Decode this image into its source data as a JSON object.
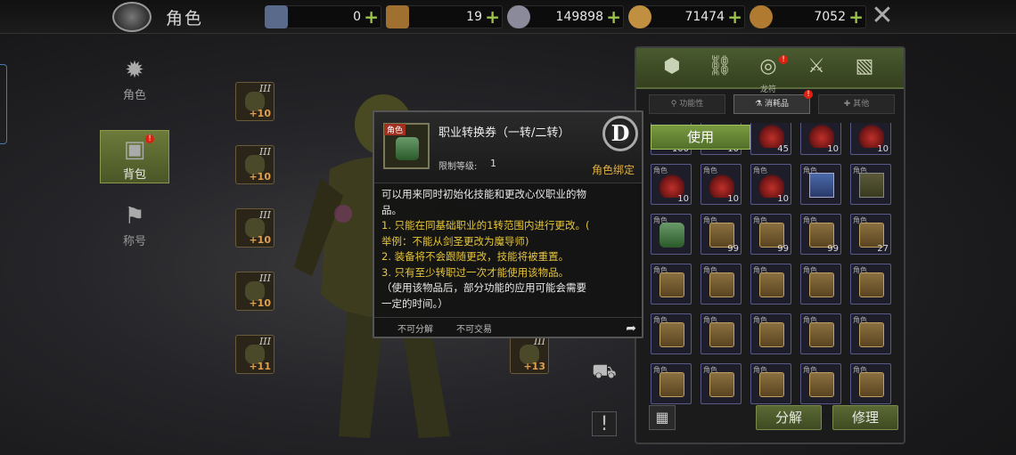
{
  "header": {
    "title": "角色",
    "currencies": [
      {
        "icon": "ticket-card-icon",
        "value": "0",
        "color": "#5a6a8a"
      },
      {
        "icon": "scroll-ticket-icon",
        "value": "19",
        "color": "#a07030"
      },
      {
        "icon": "gear-coin-icon",
        "value": "149898",
        "color": "#8a8a9a"
      },
      {
        "icon": "gold-coin-icon",
        "value": "71474",
        "color": "#c09040"
      },
      {
        "icon": "bronze-coin-icon",
        "value": "7052",
        "color": "#b07a30"
      }
    ],
    "plus": "+"
  },
  "leftnav": [
    {
      "label": "角色",
      "icon": "character-icon"
    },
    {
      "label": "背包",
      "icon": "backpack-icon",
      "badge": "!"
    },
    {
      "label": "称号",
      "icon": "title-icon"
    }
  ],
  "equip_left": [
    {
      "tier": "III",
      "level": "+10"
    },
    {
      "tier": "III",
      "level": "+10"
    },
    {
      "tier": "III",
      "level": "+10"
    },
    {
      "tier": "III",
      "level": "+10"
    },
    {
      "tier": "III",
      "level": "+11"
    }
  ],
  "equip_right": [
    {
      "tier": "III",
      "level": "+13"
    }
  ],
  "inventory": {
    "tabs": [
      {
        "icon": "cube-icon",
        "label": ""
      },
      {
        "icon": "link-icon",
        "label": ""
      },
      {
        "icon": "cosmetic-icon",
        "label": "龙符",
        "badge": "!"
      },
      {
        "icon": "sword-icon",
        "label": ""
      },
      {
        "icon": "map-icon",
        "label": ""
      }
    ],
    "subtabs": [
      {
        "label": "功能性",
        "icon": "magnifier-icon"
      },
      {
        "label": "消耗品",
        "icon": "potion-icon",
        "badge": "!"
      },
      {
        "label": "其他",
        "icon": "cross-icon"
      }
    ],
    "slots": [
      {
        "cat": "",
        "count": "100",
        "kind": "red"
      },
      {
        "cat": "",
        "count": "10",
        "kind": "red"
      },
      {
        "cat": "",
        "count": "45",
        "kind": "red"
      },
      {
        "cat": "",
        "count": "10",
        "kind": "red"
      },
      {
        "cat": "",
        "count": "10",
        "kind": "red"
      },
      {
        "cat": "角色",
        "count": "10",
        "kind": "red"
      },
      {
        "cat": "角色",
        "count": "10",
        "kind": "red"
      },
      {
        "cat": "角色",
        "count": "10",
        "kind": "red"
      },
      {
        "cat": "角色",
        "count": "",
        "kind": "book"
      },
      {
        "cat": "角色",
        "count": "",
        "kind": "box"
      },
      {
        "cat": "角色",
        "count": "",
        "kind": "scroll"
      },
      {
        "cat": "角色",
        "count": "99",
        "kind": "chest"
      },
      {
        "cat": "角色",
        "count": "99",
        "kind": "chest"
      },
      {
        "cat": "角色",
        "count": "99",
        "kind": "chest"
      },
      {
        "cat": "角色",
        "count": "27",
        "kind": "chest"
      },
      {
        "cat": "角色",
        "count": "",
        "kind": "chest"
      },
      {
        "cat": "角色",
        "count": "",
        "kind": "chest"
      },
      {
        "cat": "角色",
        "count": "",
        "kind": "chest"
      },
      {
        "cat": "角色",
        "count": "",
        "kind": "chest"
      },
      {
        "cat": "角色",
        "count": "",
        "kind": "chest"
      },
      {
        "cat": "角色",
        "count": "",
        "kind": "chest"
      },
      {
        "cat": "角色",
        "count": "",
        "kind": "chest"
      },
      {
        "cat": "角色",
        "count": "",
        "kind": "chest"
      },
      {
        "cat": "角色",
        "count": "",
        "kind": "chest"
      },
      {
        "cat": "角色",
        "count": "",
        "kind": "chest"
      },
      {
        "cat": "角色",
        "count": "",
        "kind": "chest"
      },
      {
        "cat": "角色",
        "count": "",
        "kind": "chest"
      },
      {
        "cat": "角色",
        "count": "",
        "kind": "chest"
      },
      {
        "cat": "角色",
        "count": "",
        "kind": "chest"
      },
      {
        "cat": "角色",
        "count": "",
        "kind": "chest"
      }
    ],
    "decompose": "分解",
    "repair": "修理",
    "use": "使用"
  },
  "tooltip": {
    "tag": "角色",
    "name": "职业转换券（一转/二转）",
    "level_label": "限制等级:",
    "level_value": "1",
    "grade": "D",
    "bind": "角色绑定",
    "lines": [
      {
        "text": "可以用来同时初始化技能和更改心仪职业的物",
        "color": "w"
      },
      {
        "text": "品。",
        "color": "w"
      },
      {
        "text": "1. 只能在同基础职业的1转范围内进行更改。(",
        "color": "y"
      },
      {
        "text": "举例：不能从剑圣更改为魔导师)",
        "color": "y"
      },
      {
        "text": "2. 装备将不会跟随更改，技能将被重置。",
        "color": "y"
      },
      {
        "text": "3. 只有至少转职过一次才能使用该物品。",
        "color": "y"
      },
      {
        "text": "（使用该物品后，部分功能的应用可能会需要",
        "color": "w"
      },
      {
        "text": "一定的时间。）",
        "color": "w"
      }
    ],
    "no_decompose": "不可分解",
    "no_trade": "不可交易"
  }
}
